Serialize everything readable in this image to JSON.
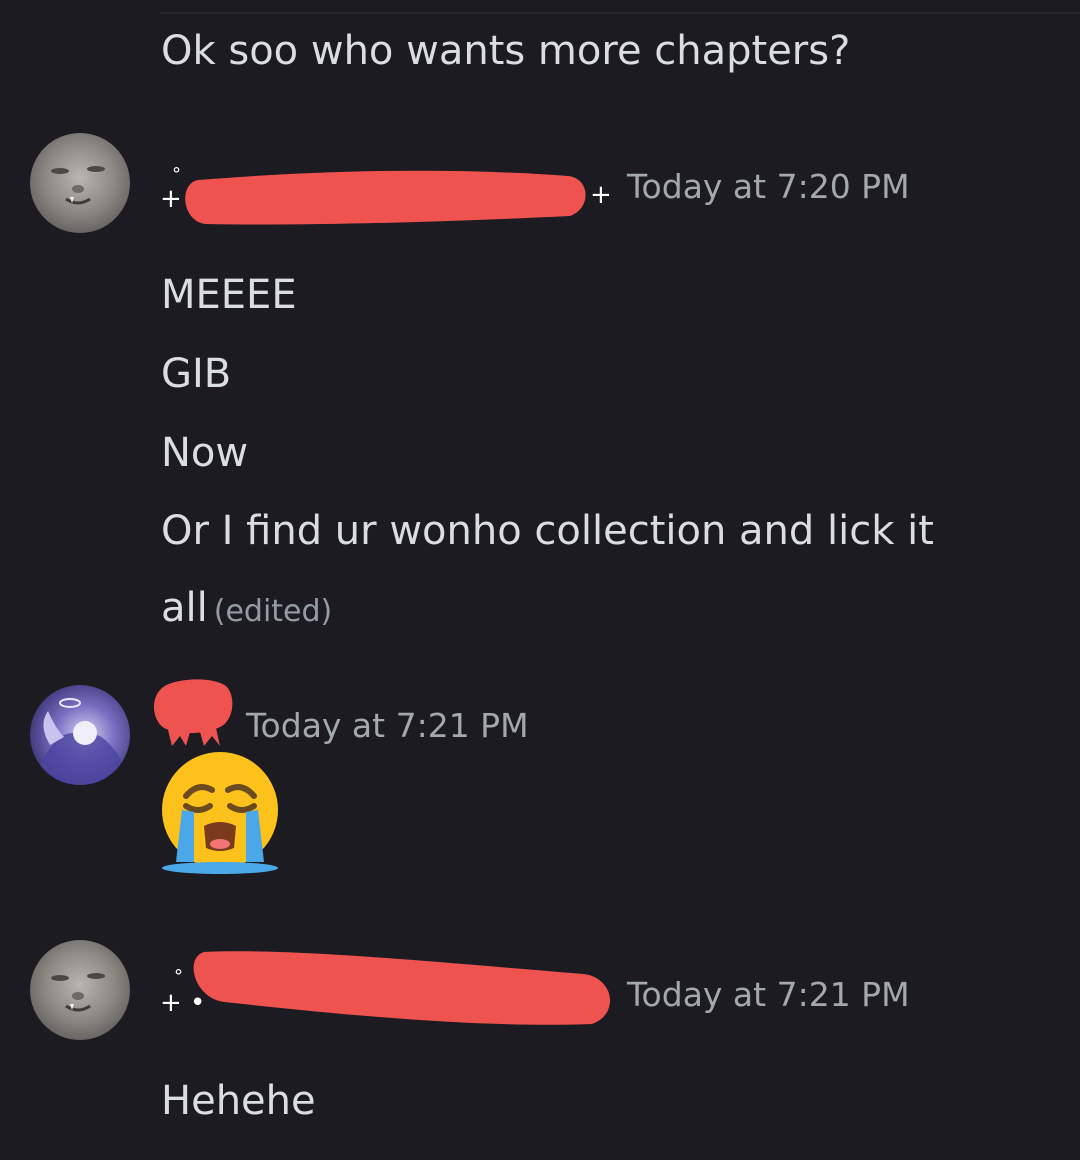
{
  "chat": {
    "previous_message": "Ok soo who wants more chapters?",
    "messages": [
      {
        "author_redacted": true,
        "avatar": "grey-cat-avatar",
        "timestamp": "Today at 7:20 PM",
        "lines": [
          "MEEEE",
          "GIB",
          "Now",
          "Or I find ur wonho collection and lick it",
          "all"
        ],
        "edited_label": "(edited)"
      },
      {
        "author_redacted": true,
        "avatar": "anime-angel-avatar",
        "timestamp": "Today at 7:21 PM",
        "emoji": "loudly-crying-face-icon"
      },
      {
        "author_redacted": true,
        "avatar": "grey-cat-avatar",
        "timestamp": "Today at 7:21 PM",
        "lines": [
          "Hehehe"
        ]
      }
    ]
  },
  "colors": {
    "background": "#1b1b21",
    "text": "#dbdee1",
    "muted": "#a3a7ae",
    "redaction": "#ef5350"
  }
}
